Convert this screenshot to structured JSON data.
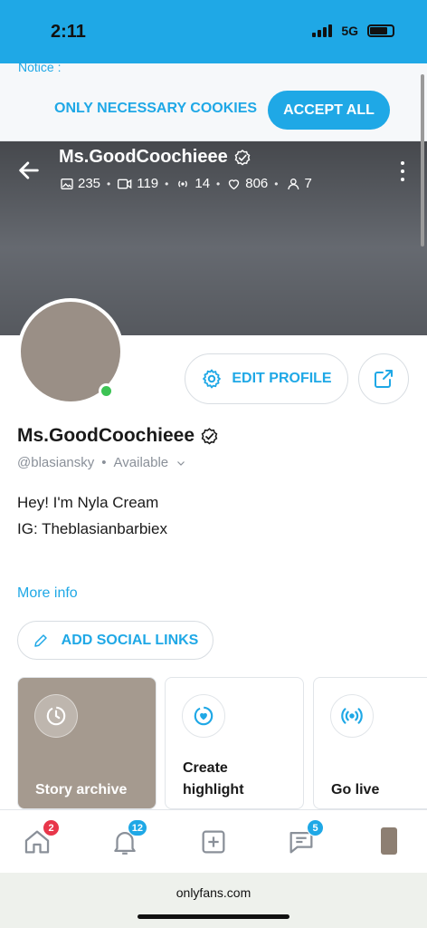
{
  "status_bar": {
    "time": "2:11",
    "network": "5G"
  },
  "cookie_banner": {
    "notice": "Notice :",
    "necessary_label": "ONLY NECESSARY COOKIES",
    "accept_label": "ACCEPT ALL"
  },
  "header": {
    "name": "Ms.GoodCoochieee",
    "stats": {
      "photos": "235",
      "videos": "119",
      "streams": "14",
      "likes": "806",
      "fans": "7"
    }
  },
  "profile": {
    "name": "Ms.GoodCoochieee",
    "handle": "@blasiansky",
    "availability": "Available",
    "edit_label": "EDIT PROFILE",
    "bio_lines": [
      "Hey! I'm Nyla Cream",
      "IG: Theblasianbarbiex"
    ],
    "more_info_label": "More info",
    "social_links_label": "ADD SOCIAL LINKS"
  },
  "highlights": [
    {
      "label": "Story archive"
    },
    {
      "label": "Create highlight"
    },
    {
      "label": "Go live"
    }
  ],
  "bottom_nav": {
    "home_badge": "2",
    "notifications_badge": "12",
    "messages_badge": "5"
  },
  "browser": {
    "url": "onlyfans.com"
  },
  "colors": {
    "accent": "#1fa8e6",
    "badge_red": "#e8364a",
    "online": "#3cc354"
  }
}
